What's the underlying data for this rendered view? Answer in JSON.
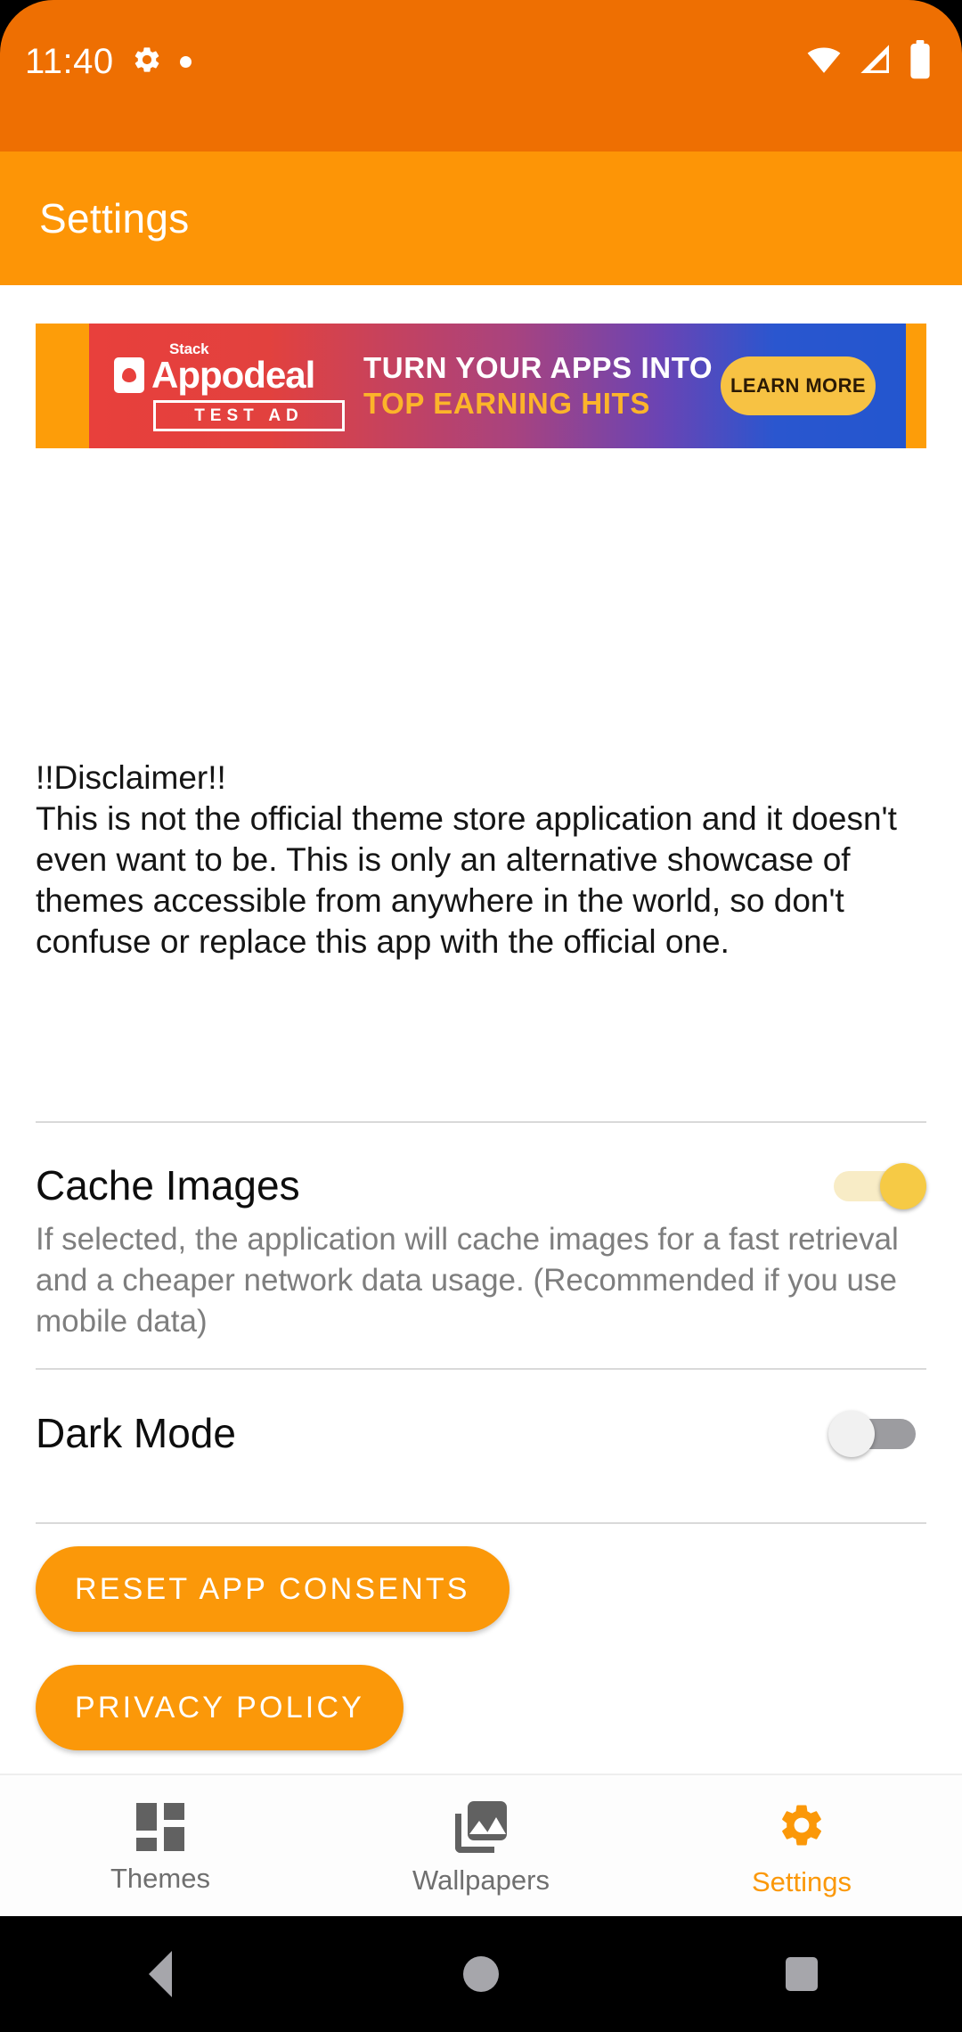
{
  "statusbar": {
    "time": "11:40",
    "icons": [
      "gear-icon",
      "dot-indicator",
      "wifi-icon",
      "cellular-signal-icon",
      "battery-icon"
    ]
  },
  "appbar": {
    "title": "Settings"
  },
  "ad": {
    "stack_label": "Stack",
    "brand": "Appodeal",
    "test_badge": "TEST AD",
    "headline_1": "TURN YOUR APPS INTO",
    "headline_2": "TOP EARNING HITS",
    "cta": "LEARN MORE"
  },
  "main": {
    "disclaimer": "!!Disclaimer!!\nThis is not the official theme store application and it doesn't even want to be. This is only an alternative showcase of themes accessible from anywhere in the world, so don't confuse or replace this app with the official one.",
    "settings": [
      {
        "title": "Cache Images",
        "description": "If selected, the application will cache images for a fast retrieval and a cheaper network data usage. (Recommended if you use mobile data)",
        "state": "on"
      },
      {
        "title": "Dark Mode",
        "description": "",
        "state": "off"
      }
    ],
    "buttons": [
      {
        "label": "RESET APP CONSENTS"
      },
      {
        "label": "PRIVACY POLICY"
      }
    ]
  },
  "bottomnav": {
    "items": [
      {
        "label": "Themes",
        "icon": "dashboard-grid-icon",
        "active": false
      },
      {
        "label": "Wallpapers",
        "icon": "photo-library-icon",
        "active": false
      },
      {
        "label": "Settings",
        "icon": "gear-icon",
        "active": true
      }
    ]
  },
  "androidnav": {
    "back": "back-triangle-icon",
    "home": "home-circle-icon",
    "recents": "recents-square-icon"
  },
  "colors": {
    "status_bar": "#ee6f02",
    "app_bar": "#fd9506",
    "accent": "#fb9809",
    "switch_on_thumb": "#f6ca45",
    "switch_on_track": "#f8ecc6",
    "switch_off_track": "#9c9ca0",
    "nav_inactive": "#6f6f6f"
  }
}
